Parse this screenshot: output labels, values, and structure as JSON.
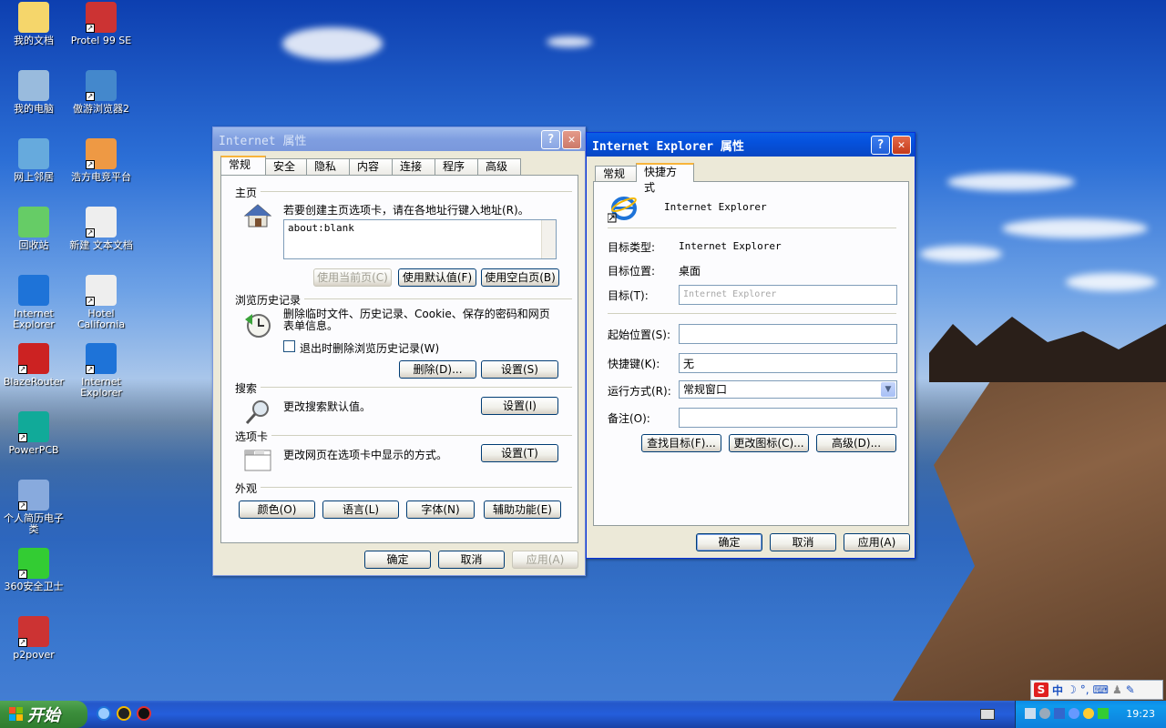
{
  "desktop": {
    "icons": [
      {
        "label": "我的文档",
        "icon": "my-documents-icon"
      },
      {
        "label": "Protel 99 SE",
        "icon": "protel-icon"
      },
      {
        "label": "我的电脑",
        "icon": "my-computer-icon"
      },
      {
        "label": "傲游浏览器2",
        "icon": "maxthon-icon"
      },
      {
        "label": "网上邻居",
        "icon": "network-icon"
      },
      {
        "label": "浩方电竞平台",
        "icon": "haofang-icon"
      },
      {
        "label": "回收站",
        "icon": "recycle-bin-icon"
      },
      {
        "label": "新建 文本文档",
        "icon": "text-document-icon"
      },
      {
        "label": "Internet Explorer",
        "icon": "ie-icon"
      },
      {
        "label": "Hotel California",
        "icon": "wav-file-icon"
      },
      {
        "label": "BlazeRouter",
        "icon": "blazerouter-icon"
      },
      {
        "label": "Internet Explorer",
        "icon": "ie-shortcut-icon"
      },
      {
        "label": "PowerPCB",
        "icon": "powerpcb-icon"
      },
      {
        "label": "个人简历电子类",
        "icon": "word-doc-icon"
      },
      {
        "label": "360安全卫士",
        "icon": "360-icon"
      },
      {
        "label": "p2pover",
        "icon": "p2pover-icon"
      }
    ]
  },
  "win_props": {
    "title": "Internet 属性",
    "tabs": [
      "常规",
      "安全",
      "隐私",
      "内容",
      "连接",
      "程序",
      "高级"
    ],
    "homepage": {
      "section": "主页",
      "desc": "若要创建主页选项卡，请在各地址行键入地址(R)。",
      "value": "about:blank",
      "btn_current": "使用当前页(C)",
      "btn_default": "使用默认值(F)",
      "btn_blank": "使用空白页(B)"
    },
    "history": {
      "section": "浏览历史记录",
      "desc": "删除临时文件、历史记录、Cookie、保存的密码和网页表单信息。",
      "checkbox": "退出时删除浏览历史记录(W)",
      "btn_delete": "删除(D)...",
      "btn_settings": "设置(S)"
    },
    "search": {
      "section": "搜索",
      "desc": "更改搜索默认值。",
      "btn_settings": "设置(I)"
    },
    "tabsec": {
      "section": "选项卡",
      "desc": "更改网页在选项卡中显示的方式。",
      "btn_settings": "设置(T)"
    },
    "appearance": {
      "section": "外观",
      "btn_colors": "颜色(O)",
      "btn_languages": "语言(L)",
      "btn_fonts": "字体(N)",
      "btn_accessibility": "辅助功能(E)"
    },
    "btn_ok": "确定",
    "btn_cancel": "取消",
    "btn_apply": "应用(A)"
  },
  "win_shortcut": {
    "title": "Internet Explorer 属性",
    "tabs": [
      "常规",
      "快捷方式"
    ],
    "name": "Internet Explorer",
    "target_type_label": "目标类型:",
    "target_type_value": "Internet Explorer",
    "target_location_label": "目标位置:",
    "target_location_value": "桌面",
    "target_label": "目标(T):",
    "target_value": "Internet Explorer",
    "start_in_label": "起始位置(S):",
    "start_in_value": "",
    "hotkey_label": "快捷键(K):",
    "hotkey_value": "无",
    "run_label": "运行方式(R):",
    "run_value": "常规窗口",
    "comment_label": "备注(O):",
    "comment_value": "",
    "btn_find": "查找目标(F)...",
    "btn_icon": "更改图标(C)...",
    "btn_advanced": "高级(D)...",
    "btn_ok": "确定",
    "btn_cancel": "取消",
    "btn_apply": "应用(A)"
  },
  "taskbar": {
    "start_label": "开始",
    "clock": "19:23",
    "ime_label": "中"
  }
}
